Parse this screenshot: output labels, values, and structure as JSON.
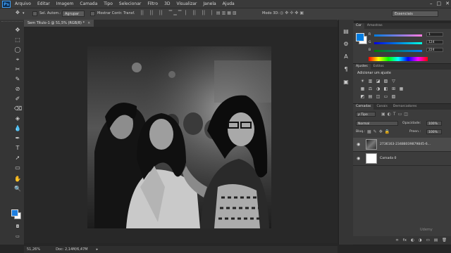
{
  "app": {
    "logo": "Ps"
  },
  "menu": [
    "Arquivo",
    "Editar",
    "Imagem",
    "Camada",
    "Tipo",
    "Selecionar",
    "Filtro",
    "3D",
    "Visualizar",
    "Janela",
    "Ajuda"
  ],
  "window_controls": [
    "–",
    "□",
    "✕"
  ],
  "options_bar": {
    "auto_select_label": "Sel. Autom.:",
    "group_select": "Agrupar",
    "show_transform_label": "Mostrar Contr. Transf.",
    "mode_3d_label": "Modo 3D:",
    "workspace": "Essenciais"
  },
  "document": {
    "tab_title": "Sem Título-1 @ 51,5% (RGB/8) *",
    "close": "×"
  },
  "status": {
    "zoom": "51,26%",
    "doc_info": "Doc: 2,14M/6,47M",
    "arrow": "▸"
  },
  "color_panel": {
    "tabs": [
      "Cor",
      "Amostras"
    ],
    "channels": [
      {
        "label": "R",
        "value": "1"
      },
      {
        "label": "G",
        "value": "124"
      },
      {
        "label": "B",
        "value": "224"
      }
    ],
    "fg_color": "#017ce0"
  },
  "adjust_panel": {
    "tabs": [
      "Ajustes",
      "Estilos"
    ],
    "heading": "Adicionar um ajuste",
    "icons_row1": [
      "☀",
      "▥",
      "◪",
      "▨",
      "▽"
    ],
    "icons_row2": [
      "▦",
      "⚖",
      "◑",
      "◧",
      "⊞",
      "▦"
    ],
    "icons_row3": [
      "◩",
      "▤",
      "◫",
      "▭",
      "▧"
    ]
  },
  "layers_panel": {
    "tabs": [
      "Camadas",
      "Canais",
      "Demarcadores"
    ],
    "filter": "ρ Tipo",
    "blend_mode": "Normal",
    "opacity_label": "Opacidade:",
    "opacity_value": "100%",
    "lock_label": "Bloq.:",
    "fill_label": "Preen.:",
    "fill_value": "100%",
    "layers": [
      {
        "name": "2736163-23488039879845-6...",
        "eye": "👁"
      },
      {
        "name": "Camada 0",
        "eye": "👁"
      }
    ],
    "footer_icons": [
      "∞",
      "fx",
      "◐",
      "◑",
      "▭",
      "▤",
      "🗑"
    ]
  },
  "tools_icons": [
    "✥",
    "⬚",
    "◯",
    "⌖",
    "✂",
    "✎",
    "⊘",
    "✐",
    "⌫",
    "◈",
    "💧",
    "✒",
    "T",
    "➚",
    "▭",
    "✋",
    "🔍"
  ],
  "right_icons": [
    "▤",
    "⚙",
    "A",
    "¶",
    "▣"
  ],
  "watermark": "Udemy"
}
